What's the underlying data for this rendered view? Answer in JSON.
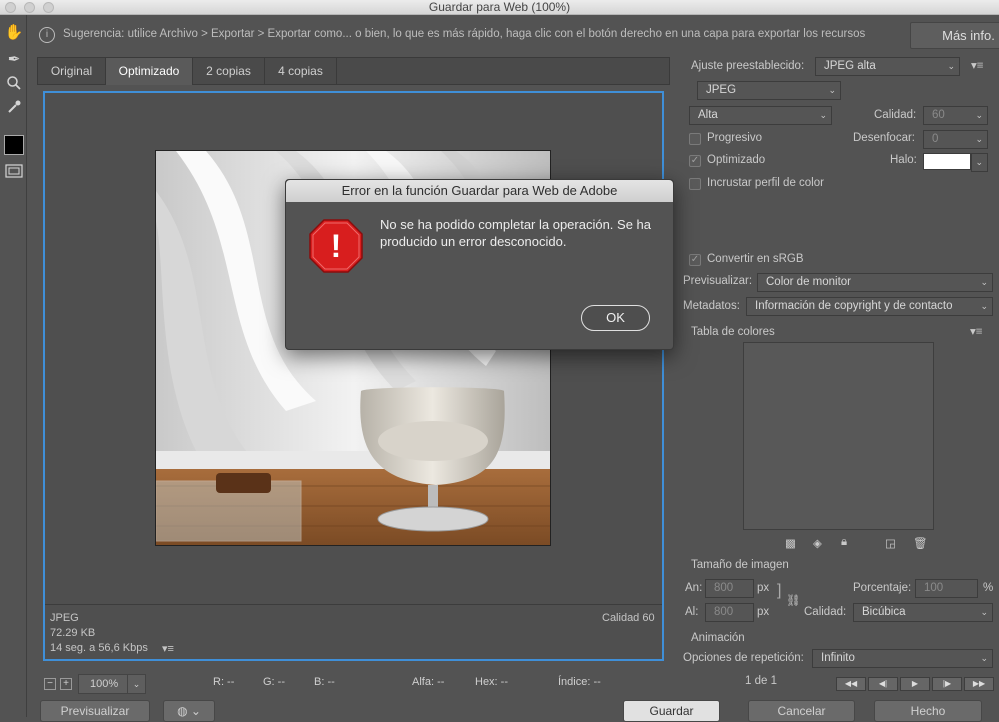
{
  "window": {
    "title": "Guardar para Web (100%)"
  },
  "infobar": {
    "tip": "Sugerencia: utilice Archivo > Exportar > Exportar como... o bien, lo que es más rápido, haga clic con el botón derecho en una capa para exportar los recursos",
    "more_label": "Más info."
  },
  "tabs": [
    "Original",
    "Optimizado",
    "2 copias",
    "4 copias"
  ],
  "preview_info": {
    "format": "JPEG",
    "size": "72.29 KB",
    "time": "14 seg. a 56,6 Kbps",
    "quality": "Calidad 60"
  },
  "bottombar": {
    "minus": "−",
    "plus": "+",
    "zoom": "100%",
    "r": "R: --",
    "g": "G: --",
    "b": "B: --",
    "alpha": "Alfa: --",
    "hex": "Hex: --",
    "index": "Índice: --"
  },
  "footer": {
    "preview": "Previsualizar",
    "save": "Guardar",
    "cancel": "Cancelar",
    "done": "Hecho"
  },
  "settings": {
    "preset_label": "Ajuste preestablecido:",
    "preset_value": "JPEG alta",
    "format_value": "JPEG",
    "compression_value": "Alta",
    "quality_label": "Calidad:",
    "quality_value": "60",
    "progressive_label": "Progresivo",
    "blur_label": "Desenfocar:",
    "blur_value": "0",
    "optimized_label": "Optimizado",
    "matte_label": "Halo:",
    "embed_profile_label": "Incrustar perfil de color",
    "convert_srgb_label": "Convertir en sRGB",
    "preview_label": "Previsualizar:",
    "preview_value": "Color de monitor",
    "metadata_label": "Metadatos:",
    "metadata_value": "Información de copyright y de contacto",
    "color_table_label": "Tabla de colores"
  },
  "image_size": {
    "section": "Tamaño de imagen",
    "w_label": "An:",
    "w_value": "800",
    "h_label": "Al:",
    "h_value": "800",
    "unit": "px",
    "percent_label": "Porcentaje:",
    "percent_value": "100",
    "percent_unit": "%",
    "quality_label": "Calidad:",
    "quality_value": "Bicúbica"
  },
  "animation": {
    "section": "Animación",
    "loop_label": "Opciones de repetición:",
    "loop_value": "Infinito",
    "frame": "1 de 1"
  },
  "dialog": {
    "title": "Error en la función Guardar para Web de Adobe",
    "message": "No se ha podido completar la operación. Se ha producido un error desconocido.",
    "ok": "OK",
    "icon_mark": "!"
  },
  "colors": {
    "accent": "#3f8fd8",
    "stop_red": "#d81e1e"
  }
}
